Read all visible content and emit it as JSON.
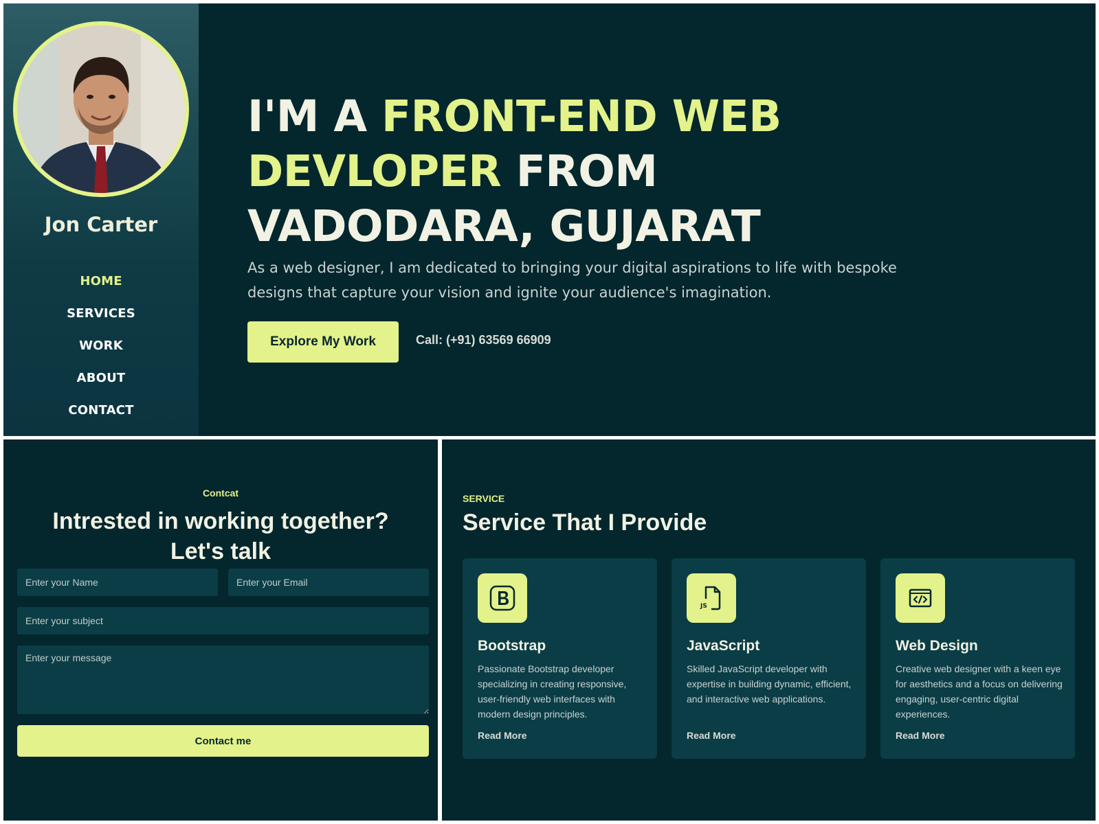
{
  "profile": {
    "name": "Jon Carter"
  },
  "nav": {
    "items": [
      {
        "label": "HOME",
        "active": true
      },
      {
        "label": "SERVICES"
      },
      {
        "label": "WORK"
      },
      {
        "label": "ABOUT"
      },
      {
        "label": "CONTACT"
      }
    ]
  },
  "hero": {
    "heading_part1": "I'M A ",
    "heading_highlight": "FRONT-END WEB DEVLOPER",
    "heading_part2": " FROM VADODARA, GUJARAT",
    "description": "As a web designer, I am dedicated to bringing your digital aspirations to life with bespoke designs that capture your vision and ignite your audience's imagination.",
    "cta_label": "Explore My Work",
    "call_text": "Call: (+91) 63569 66909"
  },
  "contact": {
    "eyebrow": "Contcat",
    "heading_line1": "Intrested in working together?",
    "heading_line2": "Let's talk",
    "name_placeholder": "Enter your Name",
    "email_placeholder": "Enter your Email",
    "subject_placeholder": "Enter your subject",
    "message_placeholder": "Enter your message",
    "submit_label": "Contact me"
  },
  "services": {
    "eyebrow": "SERVICE",
    "heading": "Service That I Provide",
    "cards": [
      {
        "icon": "bootstrap-icon",
        "title": "Bootstrap",
        "description": "Passionate Bootstrap developer specializing in creating responsive, user-friendly web interfaces with modern design principles.",
        "link": "Read More"
      },
      {
        "icon": "javascript-file-icon",
        "title": "JavaScript",
        "description": "Skilled JavaScript developer with expertise in building dynamic, efficient, and interactive web applications.",
        "link": "Read More"
      },
      {
        "icon": "code-window-icon",
        "title": "Web Design",
        "description": "Creative web designer with a keen eye for aesthetics and a focus on delivering engaging, user-centric digital experiences.",
        "link": "Read More"
      }
    ]
  },
  "colors": {
    "background": "#04262d",
    "accent": "#e3f28a",
    "card": "#0b3d46",
    "sidebar_top": "#2f5d66"
  }
}
